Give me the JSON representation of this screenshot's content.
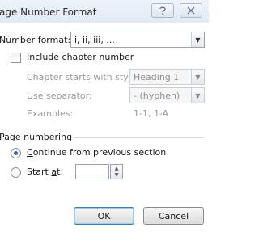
{
  "dialog": {
    "title": "age Number Format"
  },
  "number_format": {
    "label": "Number format:",
    "label_pre": "Number ",
    "label_accel": "f",
    "label_post": "ormat:",
    "value": "i, ii, iii, ..."
  },
  "include_chapter": {
    "label_pre": "Include chapter ",
    "label_accel": "n",
    "label_post": "umber",
    "checked": false
  },
  "chapter_style": {
    "label": "Chapter starts with style:",
    "value": "Heading 1"
  },
  "separator": {
    "label": "Use separator:",
    "value": "-  (hyphen)"
  },
  "examples": {
    "label": "Examples:",
    "value": "1-1, 1-A"
  },
  "page_numbering": {
    "heading": "Page numbering",
    "continue_accel": "C",
    "continue_post": "ontinue from previous section",
    "start_pre": "Start ",
    "start_accel": "a",
    "start_post": "t:",
    "start_value": "",
    "selected": "continue"
  },
  "buttons": {
    "ok": "OK",
    "cancel": "Cancel"
  },
  "icons": {
    "help": "help-icon",
    "close": "close-icon"
  },
  "colors": {
    "radio_selected": "#2a66b8",
    "default_button_border": "#3c7fb1",
    "disabled_text": "#9a9a9a"
  }
}
